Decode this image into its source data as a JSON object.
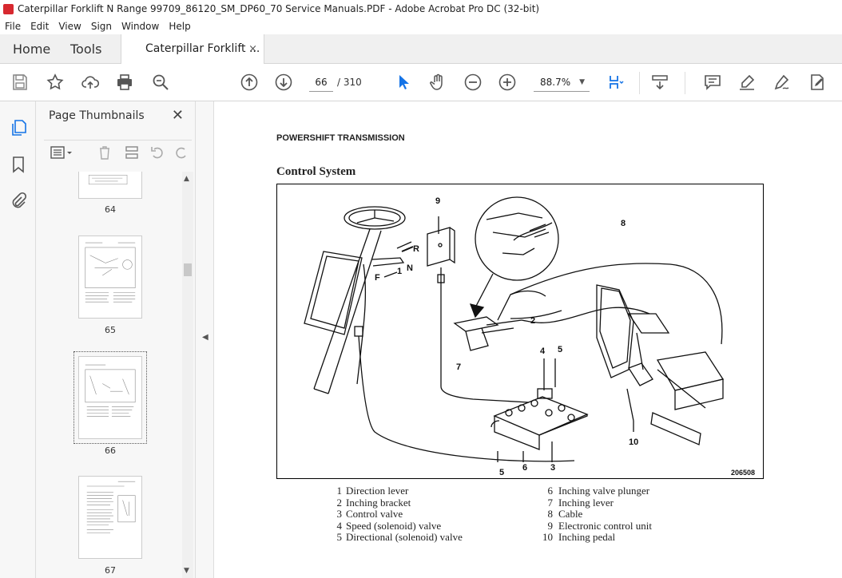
{
  "window": {
    "title": "Caterpillar Forklift N Range 99709_86120_SM_DP60_70 Service Manuals.PDF - Adobe Acrobat Pro DC (32-bit)"
  },
  "menu": [
    "File",
    "Edit",
    "View",
    "Sign",
    "Window",
    "Help"
  ],
  "tabs": {
    "home": "Home",
    "tools": "Tools",
    "document": "Caterpillar Forklift ...",
    "close": "×"
  },
  "toolbar": {
    "current_page": "66",
    "page_total": "/ 310",
    "zoom": "88.7%"
  },
  "panel": {
    "title": "Page Thumbnails",
    "close": "✕"
  },
  "thumbnails": [
    {
      "page": "64"
    },
    {
      "page": "65"
    },
    {
      "page": "66",
      "selected": true
    },
    {
      "page": "67"
    }
  ],
  "document": {
    "header": "POWERSHIFT TRANSMISSION",
    "title": "Control System",
    "figure_id": "206508",
    "callouts": [
      "1",
      "2",
      "3",
      "4",
      "5",
      "6",
      "7",
      "8",
      "9",
      "10",
      "R",
      "N",
      "F"
    ],
    "legend_left": [
      {
        "num": "1",
        "label": "Direction lever"
      },
      {
        "num": "2",
        "label": "Inching bracket"
      },
      {
        "num": "3",
        "label": "Control valve"
      },
      {
        "num": "4",
        "label": "Speed (solenoid) valve"
      },
      {
        "num": "5",
        "label": "Directional (solenoid) valve"
      }
    ],
    "legend_right": [
      {
        "num": "6",
        "label": "Inching valve plunger"
      },
      {
        "num": "7",
        "label": "Inching lever"
      },
      {
        "num": "8",
        "label": "Cable"
      },
      {
        "num": "9",
        "label": "Electronic control unit"
      },
      {
        "num": "10",
        "label": "Inching pedal"
      }
    ]
  },
  "colors": {
    "accent": "#1473e6",
    "brand": "#d7282f"
  }
}
